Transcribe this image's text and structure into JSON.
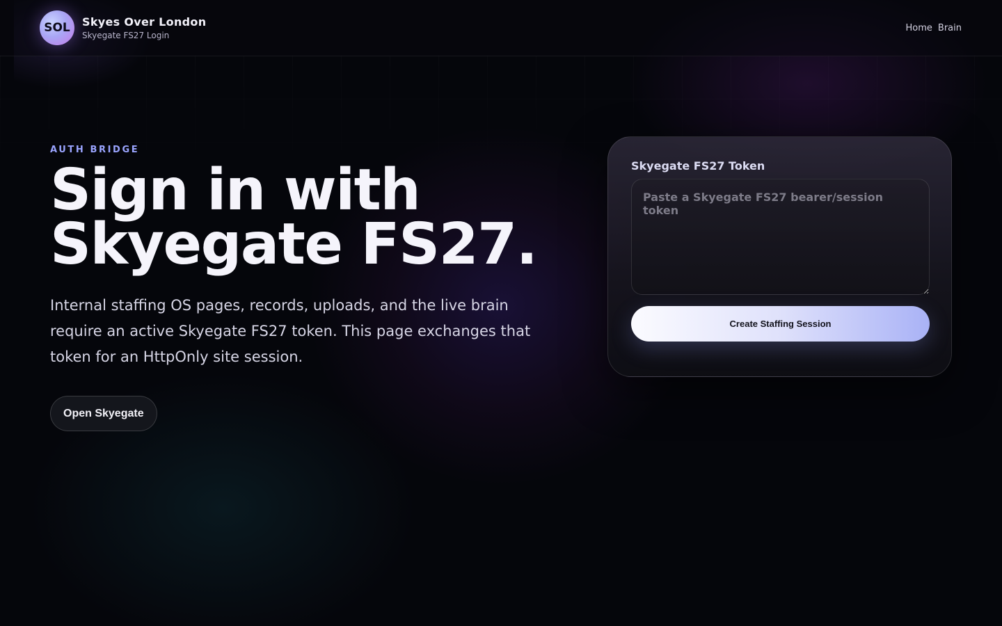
{
  "header": {
    "logo_initials": "SOL",
    "title": "Skyes Over London",
    "subtitle": "Skyegate FS27 Login",
    "nav": [
      {
        "label": "Home"
      },
      {
        "label": "Brain"
      }
    ]
  },
  "hero": {
    "eyebrow": "AUTH BRIDGE",
    "title_line1": "Sign in with",
    "title_line2": "Skyegate FS27.",
    "description": "Internal staffing OS pages, records, uploads, and the live brain require an active Skyegate FS27 token. This page exchanges that token for an HttpOnly site session.",
    "open_button": "Open Skyegate"
  },
  "card": {
    "label": "Skyegate FS27 Token",
    "token_placeholder": "Paste a Skyegate FS27 bearer/session token",
    "token_value": "",
    "submit_button": "Create Staffing Session"
  },
  "colors": {
    "accent": "#9aa4ff",
    "background": "#05060b",
    "button_gradient_end": "#a9b2f6"
  }
}
